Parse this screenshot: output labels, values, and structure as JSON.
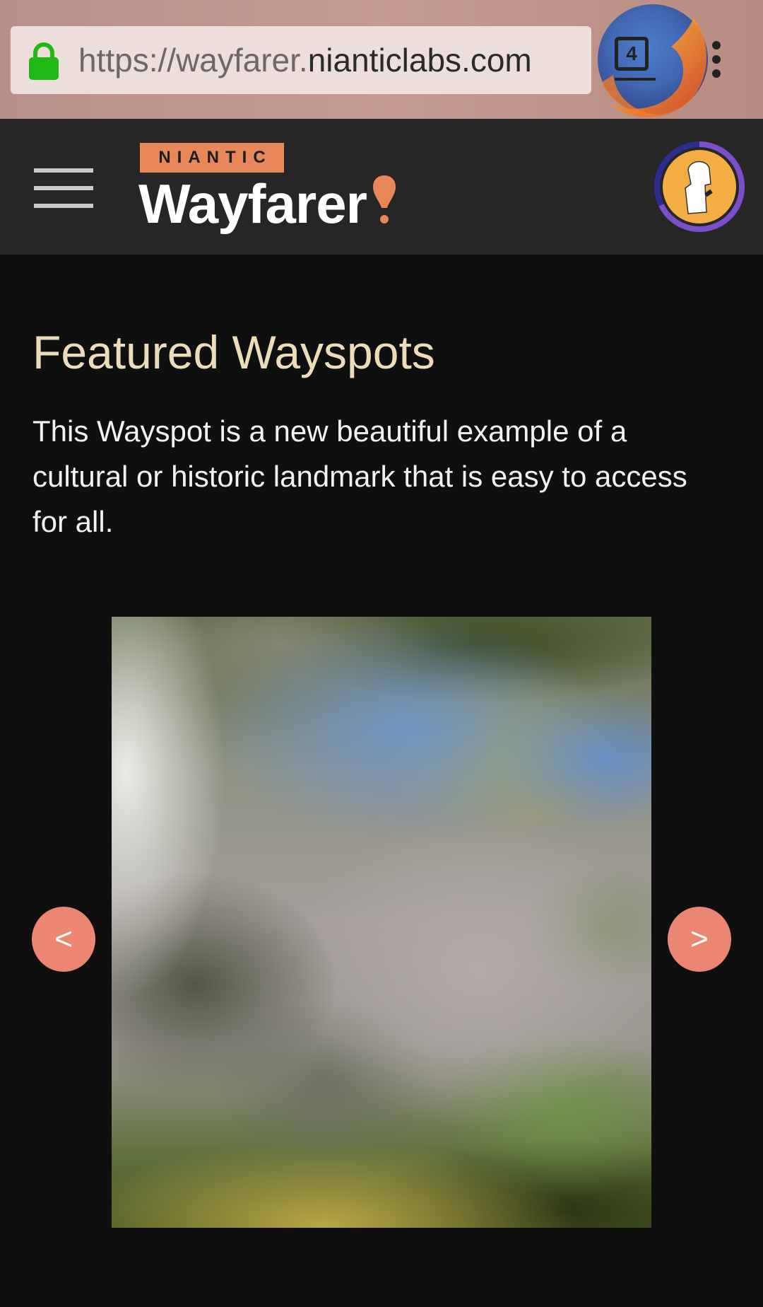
{
  "browser": {
    "url_scheme_host_prefix": "https://wayfarer.",
    "url_domain": "nianticlabs.com",
    "tab_count": "4",
    "colors": {
      "lock": "#1fb814"
    }
  },
  "header": {
    "brand_badge": "NIANTIC",
    "brand_title": "Wayfarer",
    "colors": {
      "accent": "#e8875a",
      "header_bg": "#262626"
    }
  },
  "main": {
    "title": "Featured Wayspots",
    "description": "This Wayspot is a new beautiful example of a cultural or historic landmark that is easy to access for all.",
    "prev_label": "<",
    "next_label": ">",
    "colors": {
      "title": "#ecdcba",
      "nav_button": "#ea8672"
    }
  }
}
